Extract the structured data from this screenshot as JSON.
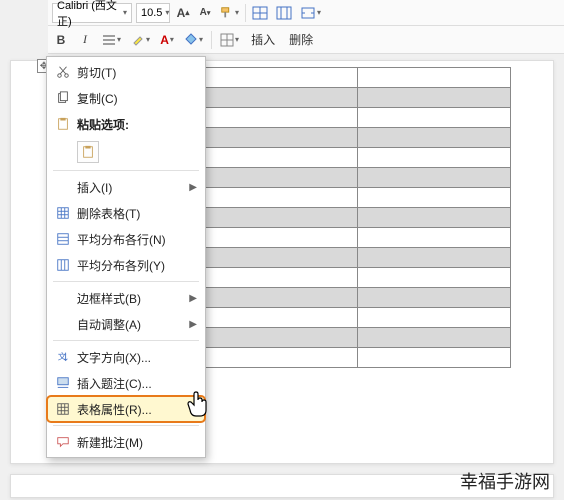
{
  "toolbar": {
    "font_name": "Calibri (西文正)",
    "font_size": "10.5",
    "insert_label": "插入",
    "delete_label": "删除"
  },
  "context_menu": {
    "cut": "剪切(T)",
    "copy": "复制(C)",
    "paste_header": "粘贴选项:",
    "insert": "插入(I)",
    "delete_table": "删除表格(T)",
    "distribute_rows": "平均分布各行(N)",
    "distribute_cols": "平均分布各列(Y)",
    "border_style": "边框样式(B)",
    "autofit": "自动调整(A)",
    "text_direction": "文字方向(X)...",
    "insert_caption": "插入题注(C)...",
    "table_properties": "表格属性(R)...",
    "new_comment": "新建批注(M)"
  },
  "watermark": "幸福手游网"
}
